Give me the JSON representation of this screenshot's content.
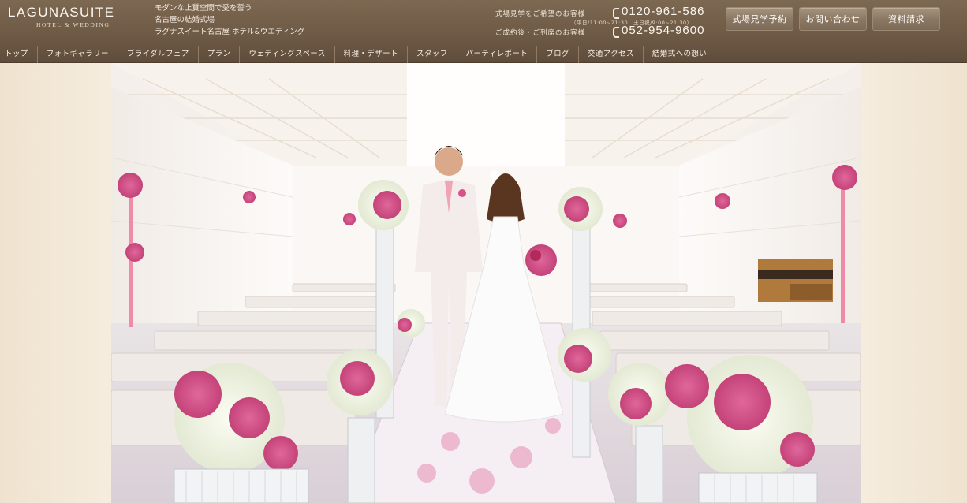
{
  "header": {
    "logo": {
      "main": "LAGUNASUITE",
      "sub": "HOTEL & WEDDING"
    },
    "tagline": [
      "モダンな上質空間で愛を誓う",
      "名古屋の結婚式場",
      "ラグナスイート名古屋 ホテル&ウエディング"
    ],
    "contact": [
      {
        "label": "式場見学をご希望のお客様",
        "number": "0120-961-586",
        "hours": "（平日/11:00~21:30　土日祝/9:00~21:30）"
      },
      {
        "label": "ご成約後・ご列席のお客様",
        "number": "052-954-9600"
      }
    ],
    "buttons": [
      {
        "label": "式場見学予約"
      },
      {
        "label": "お問い合わせ"
      },
      {
        "label": "資料請求"
      }
    ],
    "nav": [
      "トップ",
      "フォトギャラリー",
      "ブライダルフェア",
      "プラン",
      "ウェディングスペース",
      "料理・デザート",
      "スタッフ",
      "パーティレポート",
      "ブログ",
      "交通アクセス",
      "結婚式への想い"
    ]
  },
  "icons": {
    "phone": "phone-icon"
  },
  "colors": {
    "header_bg": "#6e5a45",
    "accent_pink": "#d6538a",
    "page_bg": "#f6eddf"
  }
}
